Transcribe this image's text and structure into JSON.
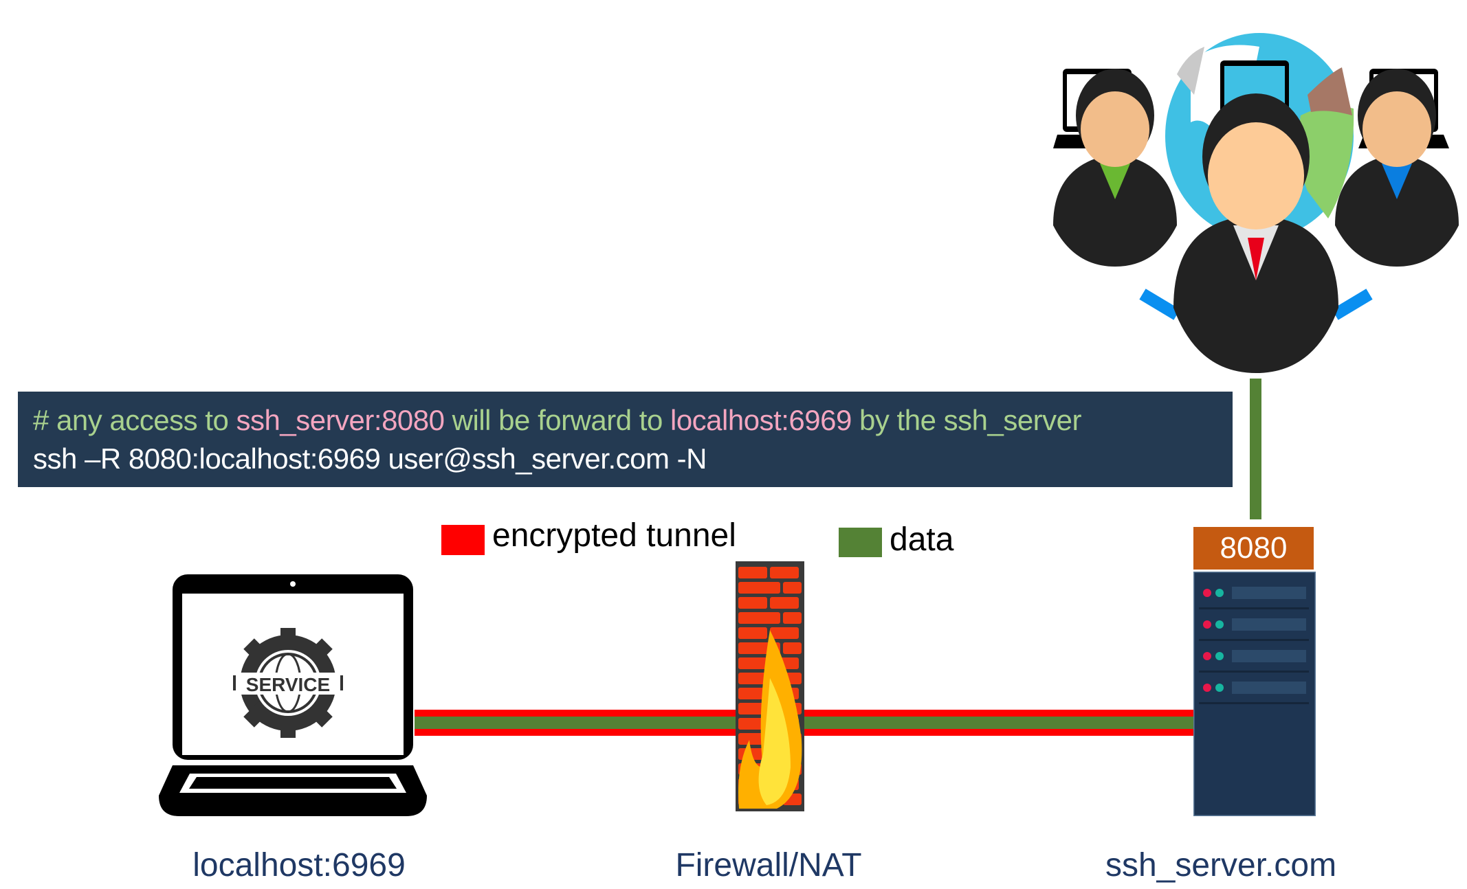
{
  "code": {
    "comment_prefix": "# any access to ",
    "comment_target": "ssh_server:8080",
    "comment_mid": " will be forward to ",
    "comment_local": "localhost:6969",
    "comment_suffix": " by the ssh_server",
    "command": "ssh –R 8080:localhost:6969 user@ssh_server.com -N"
  },
  "legend": [
    {
      "label": "encrypted tunnel",
      "color": "#ff0000"
    },
    {
      "label": "data",
      "color": "#548235"
    }
  ],
  "server_port": "8080",
  "laptop_screen_text": "SERVICE",
  "nodes": {
    "local": "localhost:6969",
    "firewall": "Firewall/NAT",
    "server": "ssh_server.com"
  },
  "colors": {
    "code_bg": "#243a52",
    "comment": "#a9d18e",
    "highlight": "#f4a6c0",
    "port_box": "#c55a11",
    "caption": "#1f3864"
  }
}
